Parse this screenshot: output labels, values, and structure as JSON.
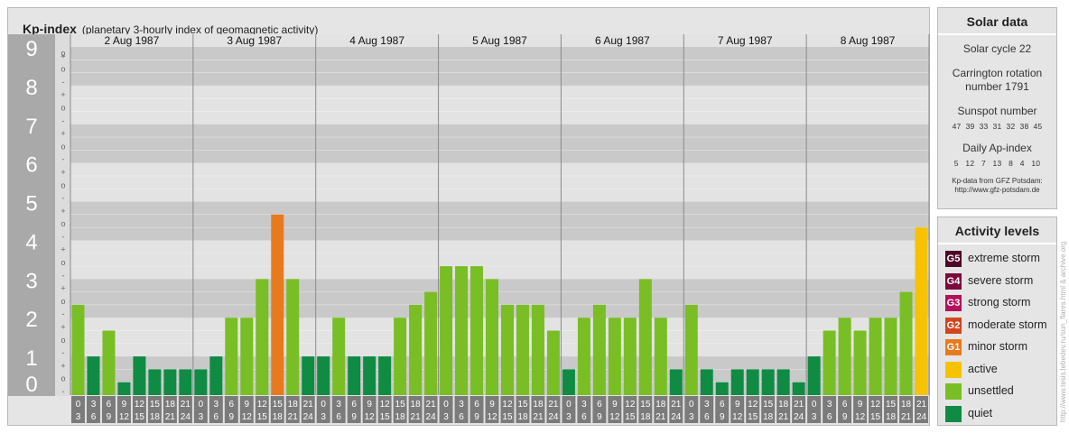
{
  "header": {
    "title": "Kp-index",
    "subtitle": "(planetary 3-hourly index of geomagnetic activity)"
  },
  "chart_data": {
    "type": "bar",
    "ylim": [
      0,
      9
    ],
    "y_major_labels": [
      "0",
      "1",
      "2",
      "3",
      "4",
      "5",
      "6",
      "7",
      "8",
      "9"
    ],
    "y_minor_labels": [
      "-",
      "o",
      "+"
    ],
    "days": [
      "2 Aug 1987",
      "3 Aug 1987",
      "4 Aug 1987",
      "5 Aug 1987",
      "6 Aug 1987",
      "7 Aug 1987",
      "8 Aug 1987"
    ],
    "interval_labels": [
      [
        "0",
        "3"
      ],
      [
        "3",
        "6"
      ],
      [
        "6",
        "9"
      ],
      [
        "9",
        "12"
      ],
      [
        "12",
        "15"
      ],
      [
        "15",
        "18"
      ],
      [
        "18",
        "21"
      ],
      [
        "21",
        "24"
      ]
    ],
    "values": [
      [
        2.333,
        1.0,
        1.667,
        0.333,
        1.0,
        0.667,
        0.667,
        0.667
      ],
      [
        0.667,
        1.0,
        2.0,
        2.0,
        3.0,
        4.667,
        3.0,
        1.0
      ],
      [
        1.0,
        2.0,
        1.0,
        1.0,
        1.0,
        2.0,
        2.333,
        2.667
      ],
      [
        3.333,
        3.333,
        3.333,
        3.0,
        2.333,
        2.333,
        2.333,
        1.667
      ],
      [
        0.667,
        2.0,
        2.333,
        2.0,
        2.0,
        3.0,
        2.0,
        0.667
      ],
      [
        2.333,
        0.667,
        0.333,
        0.667,
        0.667,
        0.667,
        0.667,
        0.333
      ],
      [
        1.0,
        1.667,
        2.0,
        1.667,
        2.0,
        2.0,
        2.667,
        4.333
      ]
    ],
    "level_colors": {
      "quiet": "#0f8b43",
      "unsettled": "#79be24",
      "active": "#f7c200",
      "G1": "#e87a1e",
      "G2": "#d2451f",
      "G3": "#b40f5a",
      "G4": "#7d0a3e",
      "G5": "#4e0628"
    }
  },
  "solar": {
    "title": "Solar data",
    "cycle": "Solar cycle 22",
    "carrington_line1": "Carrington rotation",
    "carrington_line2": "number 1791",
    "sunspot_title": "Sunspot number",
    "sunspot_values": "47  39  33  31  32  38  45",
    "ap_title": "Daily Ap-index",
    "ap_values": "5   12   7   13   8   4   10",
    "credit_line1": "Kp-data from  GFZ Potsdam:",
    "credit_line2": "http://www.gfz-potsdam.de"
  },
  "activity": {
    "title": "Activity levels",
    "levels": [
      {
        "code": "G5",
        "label": "extreme storm",
        "color": "#4e0628"
      },
      {
        "code": "G4",
        "label": "severe storm",
        "color": "#7d0a3e"
      },
      {
        "code": "G3",
        "label": "strong storm",
        "color": "#b40f5a"
      },
      {
        "code": "G2",
        "label": "moderate storm",
        "color": "#d2451f"
      },
      {
        "code": "G1",
        "label": "minor storm",
        "color": "#e87a1e"
      },
      {
        "code": "",
        "label": "active",
        "color": "#f7c200"
      },
      {
        "code": "",
        "label": "unsettled",
        "color": "#79be24"
      },
      {
        "code": "",
        "label": "quiet",
        "color": "#0f8b43"
      }
    ]
  },
  "watermark": "http://www.tesis.lebedev.ru/sun_flares.html & archive.org"
}
